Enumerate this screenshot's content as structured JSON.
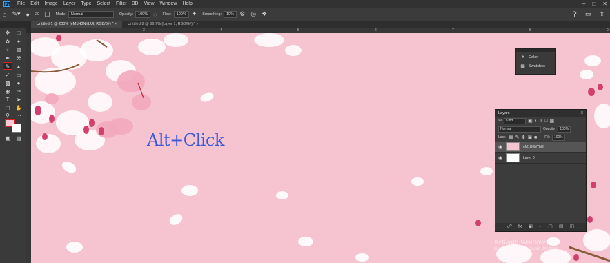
{
  "app": {
    "logo": "Ps"
  },
  "menu": [
    "File",
    "Edit",
    "Image",
    "Layer",
    "Type",
    "Select",
    "Filter",
    "3D",
    "View",
    "Window",
    "Help"
  ],
  "options_bar": {
    "brush_size": "20",
    "mode_label": "Mode:",
    "mode_value": "Normal",
    "opacity_label": "Opacity:",
    "opacity_value": "100%",
    "flow_label": "Flow:",
    "flow_value": "100%",
    "smoothing_label": "Smoothing:",
    "smoothing_value": "10%"
  },
  "tabs": [
    {
      "label": "Untitled-1 @ 200% (eM1H0NYbUl, RGB/8#) *",
      "close": "×"
    },
    {
      "label": "Untitled-2 @ 66.7% (Layer 1, RGB/8#) *",
      "close": "×"
    }
  ],
  "ruler": {
    "top_marks": [
      "3",
      "4",
      "5",
      "6",
      "7",
      "8",
      "9"
    ]
  },
  "canvas": {
    "annotation": "Alt+Click",
    "background_color": "#f6c4d1"
  },
  "mini_panel": {
    "items": [
      {
        "label": "Color",
        "icon": "palette-icon"
      },
      {
        "label": "Swatches",
        "icon": "grid-icon"
      }
    ]
  },
  "layers_panel": {
    "title": "Layers",
    "filter_value": "Kind",
    "blend_mode": "Normal",
    "opacity_label": "Opacity:",
    "opacity_value": "100%",
    "lock_label": "Lock:",
    "fill_label": "Fill:",
    "fill_value": "100%",
    "layers": [
      {
        "name": "eM1H0NYbUl",
        "thumb_color": "#f6c4d1",
        "selected": true
      },
      {
        "name": "Layer 0",
        "thumb_color": "#ffffff",
        "selected": false
      }
    ]
  },
  "watermark": {
    "title": "Activate Windows",
    "subtitle": "Go to Settings to activate Windows."
  }
}
